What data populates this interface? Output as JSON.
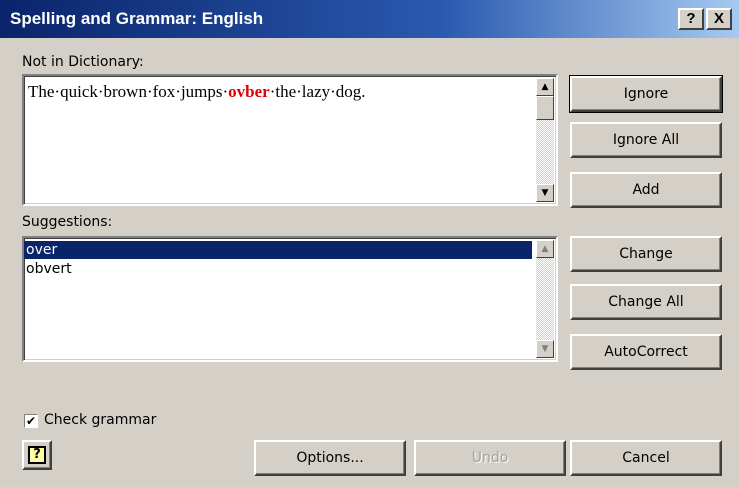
{
  "window": {
    "title": "Spelling and Grammar: English",
    "help_button": "?",
    "close_button": "X"
  },
  "not_in_dictionary": {
    "label": "Not in Dictionary:",
    "text_before": "The·quick·brown·fox·jumps·",
    "error_word": "ovber",
    "text_after": "·the·lazy·dog."
  },
  "suggestions": {
    "label": "Suggestions:",
    "items": [
      "over",
      "obvert"
    ],
    "selected_index": 0
  },
  "buttons": {
    "ignore": "Ignore",
    "ignore_all": "Ignore All",
    "add": "Add",
    "change": "Change",
    "change_all": "Change All",
    "autocorrect": "AutoCorrect",
    "options": "Options...",
    "undo": "Undo",
    "cancel": "Cancel"
  },
  "check_grammar": {
    "label": "Check grammar",
    "checked": true,
    "mark": "✔"
  },
  "assistant_icon": "?",
  "colors": {
    "title_bar_start": "#0a246a",
    "title_bar_end": "#a6caf0",
    "dialog_bg": "#d4d0c8",
    "error_text": "#e00000",
    "selection_bg": "#0a246a"
  },
  "scroll_glyphs": {
    "up": "▲",
    "down": "▼"
  }
}
